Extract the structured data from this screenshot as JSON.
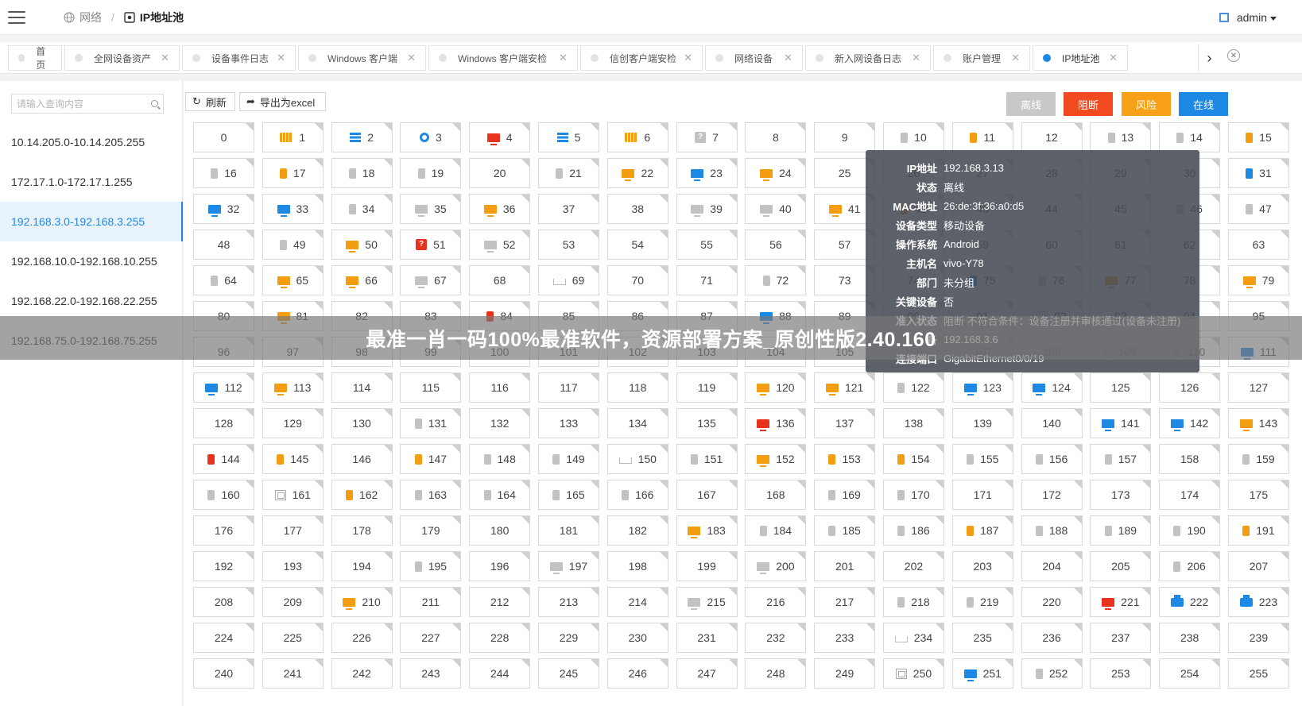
{
  "header": {
    "breadcrumb": {
      "network": "网络",
      "current": "IP地址池"
    },
    "user": "admin"
  },
  "tabs": [
    {
      "label": "首页",
      "closable": false,
      "active": false
    },
    {
      "label": "全网设备资产",
      "closable": true,
      "active": false
    },
    {
      "label": "设备事件日志",
      "closable": true,
      "active": false
    },
    {
      "label": "Windows 客户端",
      "closable": true,
      "active": false
    },
    {
      "label": "Windows 客户端安检",
      "closable": true,
      "active": false
    },
    {
      "label": "信创客户端安检",
      "closable": true,
      "active": false
    },
    {
      "label": "网络设备",
      "closable": true,
      "active": false
    },
    {
      "label": "新入网设备日志",
      "closable": true,
      "active": false
    },
    {
      "label": "账户管理",
      "closable": true,
      "active": false
    },
    {
      "label": "IP地址池",
      "closable": true,
      "active": true
    }
  ],
  "sidebar": {
    "search_placeholder": "请输入查询内容",
    "ranges": [
      "10.14.205.0-10.14.205.255",
      "172.17.1.0-172.17.1.255",
      "192.168.3.0-192.168.3.255",
      "192.168.10.0-192.168.10.255",
      "192.168.22.0-192.168.22.255",
      "192.168.75.0-192.168.75.255"
    ],
    "active_index": 2
  },
  "toolbar": {
    "refresh": "刷新",
    "export": "导出为excel"
  },
  "legend": [
    {
      "label": "离线",
      "color": "#c8c8c8"
    },
    {
      "label": "阻断",
      "color": "#f24a20"
    },
    {
      "label": "风险",
      "color": "#f8a018"
    },
    {
      "label": "在线",
      "color": "#1e88e5"
    }
  ],
  "cell_icons": {
    "1": "cam",
    "2": "server",
    "3": "loc",
    "4": "pc-red",
    "5": "server",
    "6": "cam",
    "7": "unknown-grey",
    "10": "phone-grey",
    "11": "phone-orange",
    "13": "phone-grey",
    "14": "phone-grey",
    "15": "phone-orange",
    "16": "phone-grey",
    "17": "phone-orange",
    "18": "phone-grey",
    "19": "phone-grey",
    "21": "phone-grey",
    "22": "pc-orange",
    "23": "pc-blue",
    "24": "pc-orange",
    "31": "phone-blue",
    "32": "pc-blue",
    "33": "pc-blue",
    "34": "phone-grey",
    "35": "pc-grey",
    "36": "pc-orange",
    "39": "pc-grey",
    "40": "pc-grey",
    "41": "pc-orange",
    "42": "phone-orange",
    "46": "phone-grey",
    "47": "phone-grey",
    "49": "phone-grey",
    "50": "pc-orange",
    "51": "unknown-red",
    "52": "pc-grey",
    "58": "phone-grey",
    "64": "phone-grey",
    "65": "pc-orange",
    "66": "pc-orange",
    "67": "pc-grey",
    "69": "router",
    "72": "phone-grey",
    "75": "phone-blue",
    "76": "phone-grey",
    "77": "pc-orange",
    "79": "pc-orange",
    "81": "pc-orange",
    "84": "phone-red",
    "88": "pc-blue",
    "92": "vm",
    "109": "phone-grey",
    "110": "phone-grey",
    "111": "pc-blue",
    "112": "pc-blue",
    "113": "pc-orange",
    "120": "pc-orange",
    "121": "pc-orange",
    "122": "phone-grey",
    "123": "pc-blue",
    "124": "pc-blue",
    "131": "phone-grey",
    "136": "pc-red",
    "141": "pc-blue",
    "142": "pc-blue",
    "143": "pc-orange",
    "144": "phone-red",
    "145": "phone-orange",
    "147": "phone-orange",
    "148": "phone-grey",
    "149": "phone-grey",
    "150": "router",
    "151": "phone-grey",
    "152": "pc-orange",
    "153": "phone-orange",
    "154": "phone-orange",
    "155": "phone-grey",
    "156": "phone-grey",
    "157": "phone-grey",
    "159": "phone-grey",
    "160": "phone-grey",
    "161": "vm",
    "162": "phone-orange",
    "163": "phone-grey",
    "164": "phone-grey",
    "165": "phone-grey",
    "166": "phone-grey",
    "169": "phone-grey",
    "170": "phone-grey",
    "183": "pc-orange",
    "184": "phone-grey",
    "185": "phone-grey",
    "186": "phone-grey",
    "187": "phone-orange",
    "188": "phone-grey",
    "189": "phone-grey",
    "190": "phone-grey",
    "191": "phone-orange",
    "195": "phone-grey",
    "197": "pc-grey",
    "200": "pc-grey",
    "206": "phone-grey",
    "210": "pc-orange",
    "215": "pc-grey",
    "218": "phone-grey",
    "219": "phone-grey",
    "221": "pc-red",
    "222": "printer",
    "223": "printer",
    "234": "router",
    "250": "vm",
    "251": "pc-blue",
    "252": "phone-grey"
  },
  "tooltip": [
    {
      "key": "IP地址",
      "value": "192.168.3.13"
    },
    {
      "key": "状态",
      "value": "离线"
    },
    {
      "key": "MAC地址",
      "value": "26:de:3f:36:a0:d5"
    },
    {
      "key": "设备类型",
      "value": "移动设备"
    },
    {
      "key": "操作系统",
      "value": "Android"
    },
    {
      "key": "主机名",
      "value": "vivo-Y78"
    },
    {
      "key": "部门",
      "value": "未分组"
    },
    {
      "key": "关键设备",
      "value": "否"
    },
    {
      "key": "准入状态",
      "value": "阻断 不符合条件：设备注册并审核通过(设备未注册)"
    },
    {
      "key": "备",
      "value": "192.168.3.6"
    },
    {
      "key": "连接端口",
      "value": "GigabitEthernet0/0/19"
    }
  ],
  "banner": "最准一肖一码100%最准软件，资源部署方案_原创性版2.40.160",
  "colors": {
    "accent": "#1e88e5",
    "orange": "#f29d12",
    "red": "#e8321e",
    "grey": "#c2c2c2"
  }
}
